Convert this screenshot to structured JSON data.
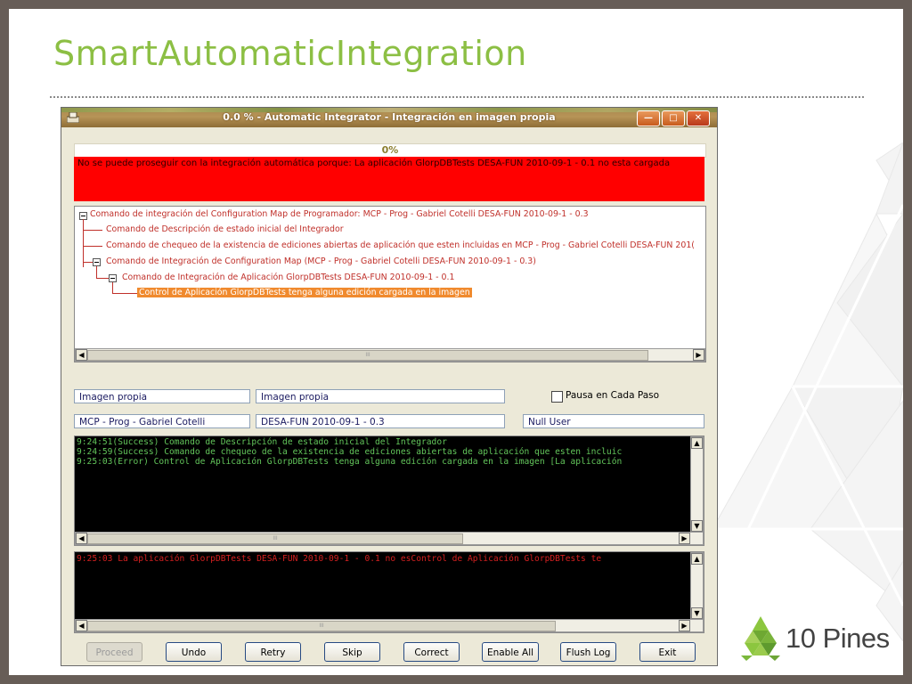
{
  "slide": {
    "title": "SmartAutomaticIntegration",
    "brand": "10 Pines",
    "accent_color": "#8cbf44",
    "frame_color": "#675d57"
  },
  "window": {
    "title": "0.0 % - Automatic Integrator - Integración en imagen propia",
    "controls": [
      "minimize-icon",
      "maximize-icon",
      "close-icon"
    ],
    "progress_label": "0%",
    "error_message": "No se puede proseguir con la integración automática porque: La aplicación GlorpDBTests DESA-FUN 2010-09-1 - 0.1 no esta cargada",
    "tree": [
      "Comando de integración del Configuration Map de Programador: MCP - Prog - Gabriel Cotelli DESA-FUN 2010-09-1 - 0.3",
      "Comando de Descripción de estado inicial del Integrador",
      "Comando de chequeo de la existencia de ediciones abiertas de aplicación que esten incluidas en MCP - Prog - Gabriel Cotelli DESA-FUN 201(",
      "Comando de Integración de Configuration Map (MCP - Prog - Gabriel Cotelli DESA-FUN 2010-09-1 - 0.3)",
      "Comando de Integración de Aplicación GlorpDBTests DESA-FUN 2010-09-1 - 0.1",
      "Control de Aplicación GlorpDBTests tenga alguna edición cargada en la imagen"
    ],
    "fields": {
      "image_source": "Imagen propia",
      "image_target": "Imagen propia",
      "config_map": "MCP - Prog - Gabriel Cotelli",
      "version": "DESA-FUN 2010-09-1 - 0.3",
      "user": "Null User"
    },
    "pause_label": "Pausa en Cada Paso",
    "pause_checked": false,
    "log_lines": [
      "9:24:51(Success) Comando de Descripción de estado inicial del Integrador",
      "9:24:59(Success) Comando de chequeo de la existencia de ediciones abiertas de aplicación que esten incluic",
      "9:25:03(Error) Control de Aplicación GlorpDBTests tenga alguna edición cargada en la imagen [La aplicación"
    ],
    "error_log_line": "9:25:03    La aplicación GlorpDBTests DESA-FUN 2010-09-1 - 0.1 no esControl de Aplicación GlorpDBTests te",
    "buttons": {
      "proceed": "Proceed",
      "undo": "Undo",
      "retry": "Retry",
      "skip": "Skip",
      "correct": "Correct",
      "enable_all": "Enable All",
      "flush_log": "Flush Log",
      "exit": "Exit"
    },
    "scroll_grip": "III"
  }
}
